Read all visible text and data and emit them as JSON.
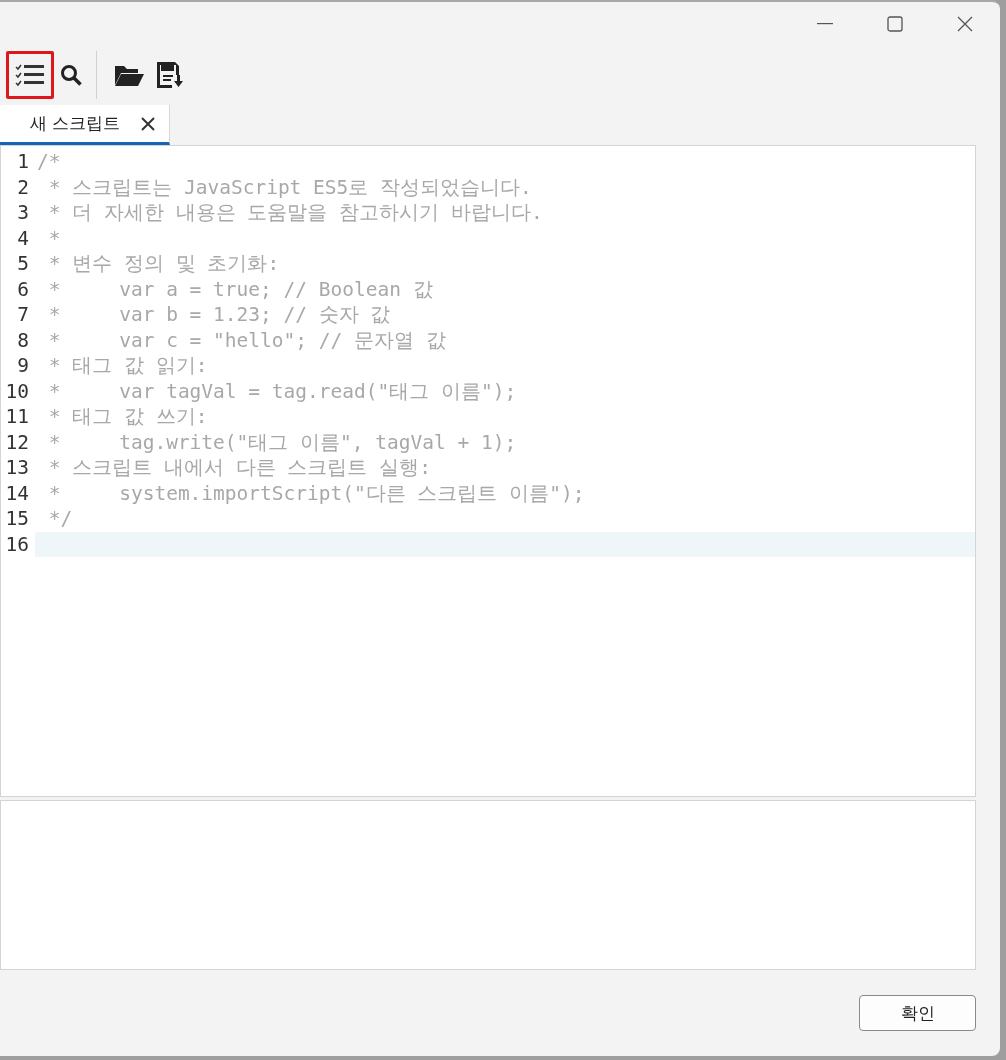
{
  "toolbar": {
    "tools": [
      {
        "kind": "checklist",
        "highlighted": true
      },
      {
        "kind": "search",
        "highlighted": false
      },
      {
        "kind": "folder",
        "highlighted": false
      },
      {
        "kind": "save",
        "highlighted": false
      }
    ]
  },
  "tabs": [
    {
      "label": "새 스크립트",
      "selected": true
    }
  ],
  "editor": {
    "lines": [
      {
        "number": "1",
        "text": "/*",
        "current": false
      },
      {
        "number": "2",
        "text": " * 스크립트는 JavaScript ES5로 작성되었습니다.",
        "current": false
      },
      {
        "number": "3",
        "text": " * 더 자세한 내용은 도움말을 참고하시기 바랍니다.",
        "current": false
      },
      {
        "number": "4",
        "text": " *",
        "current": false
      },
      {
        "number": "5",
        "text": " * 변수 정의 및 초기화:",
        "current": false
      },
      {
        "number": "6",
        "text": " *     var a = true; // Boolean 값",
        "current": false
      },
      {
        "number": "7",
        "text": " *     var b = 1.23; // 숫자 값",
        "current": false
      },
      {
        "number": "8",
        "text": " *     var c = \"hello\"; // 문자열 값",
        "current": false
      },
      {
        "number": "9",
        "text": " * 태그 값 읽기:",
        "current": false
      },
      {
        "number": "10",
        "text": " *     var tagVal = tag.read(\"태그 이름\");",
        "current": false
      },
      {
        "number": "11",
        "text": " * 태그 값 쓰기:",
        "current": false
      },
      {
        "number": "12",
        "text": " *     tag.write(\"태그 이름\", tagVal + 1);",
        "current": false
      },
      {
        "number": "13",
        "text": " * 스크립트 내에서 다른 스크립트 실행:",
        "current": false
      },
      {
        "number": "14",
        "text": " *     system.importScript(\"다른 스크립트 이름\");",
        "current": false
      },
      {
        "number": "15",
        "text": " */",
        "current": false
      },
      {
        "number": "16",
        "current": true
      }
    ]
  },
  "buttons": [
    "확인"
  ]
}
